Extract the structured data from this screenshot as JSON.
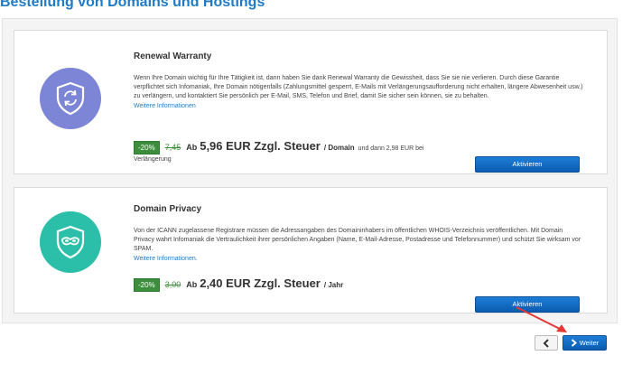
{
  "page": {
    "title": "Bestellung von Domains und Hostings"
  },
  "cards": [
    {
      "title": "Renewal Warranty",
      "icon": "shield-refresh-icon",
      "icon_bg": "#7d86d6",
      "description": "Wenn Ihre Domain wichtig für Ihre Tätigkeit ist, dann haben Sie dank Renewal Warranty die Gewissheit, dass Sie sie nie verlieren. Durch diese Garantie verpflichtet sich Infomaniak, Ihre Domain nötigenfalls (Zahlungsmittel gesperrt, E-Mails mit Verlängerungsaufforderung nicht erhalten, längere Abwesenheit usw.) zu verlängern, und kontaktiert Sie persönlich per E-Mail, SMS, Telefon und Brief, damit Sie sicher sein können, sie zu behalten.",
      "more_link": "Weitere Informationen",
      "discount": "-20%",
      "old_price": "7,45",
      "ab": "Ab",
      "new_price": "5,96 EUR Zzgl. Steuer",
      "unit": "/ Domain",
      "renewal": "und dann 2,98 EUR bei",
      "renewal_2": "Verlängerung",
      "button": "Aktivieren"
    },
    {
      "title": "Domain Privacy",
      "icon": "shield-mask-icon",
      "icon_bg": "#2bbfa9",
      "description": "Von der ICANN zugelassene Registrare müssen die Adressangaben des Domaininhabers im öffentlichen WHOIS-Verzeichnis veröffentlichen. Mit Domain Privacy wahrt Infomaniak die Vertraulichkeit ihrer persönlichen Angaben (Name, E-Mail-Adresse, Postadresse und Telefonnummer) und schützt Sie wirksam vor SPAM.",
      "more_link": "Weitere Informationen.",
      "discount": "-20%",
      "old_price": "3,00",
      "ab": "Ab",
      "new_price": "2,40 EUR Zzgl. Steuer",
      "unit": "/ Jahr",
      "button": "Aktivieren"
    }
  ],
  "nav": {
    "back_icon": "chevron-left-icon",
    "next_icon": "chevron-right-icon",
    "next_label": "Weiter"
  },
  "colors": {
    "accent": "#1e7bc4",
    "button": "#0b5cb0",
    "discount": "#3c8e3c",
    "annotation": "#e53935"
  }
}
